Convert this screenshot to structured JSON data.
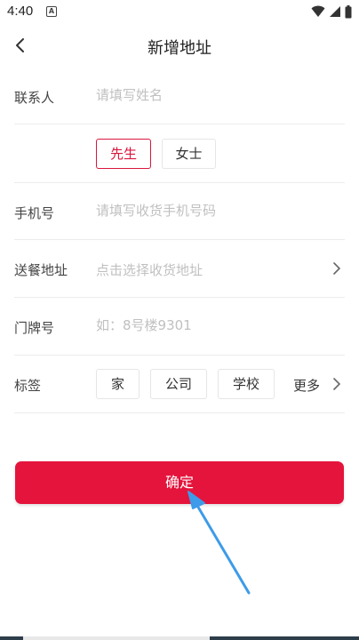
{
  "status_bar": {
    "time": "4:40",
    "notification_icon_letter": "A",
    "icons": [
      "wifi-icon",
      "signal-icon",
      "battery-icon"
    ]
  },
  "header": {
    "title": "新增地址",
    "back_icon": "chevron-left-icon"
  },
  "form": {
    "contact": {
      "label": "联系人",
      "placeholder": "请填写姓名"
    },
    "gender": {
      "options": [
        "先生",
        "女士"
      ],
      "selected": "先生"
    },
    "phone": {
      "label": "手机号",
      "placeholder": "请填写收货手机号码"
    },
    "address": {
      "label": "送餐地址",
      "placeholder": "点击选择收货地址"
    },
    "door": {
      "label": "门牌号",
      "placeholder": "如：8号楼9301"
    },
    "tags": {
      "label": "标签",
      "options": [
        "家",
        "公司",
        "学校"
      ],
      "more": "更多"
    }
  },
  "confirm_button": {
    "label": "确定"
  },
  "colors": {
    "accent": "#e5143c",
    "selected_border": "#d9163d",
    "arrow": "#3d9be9"
  }
}
